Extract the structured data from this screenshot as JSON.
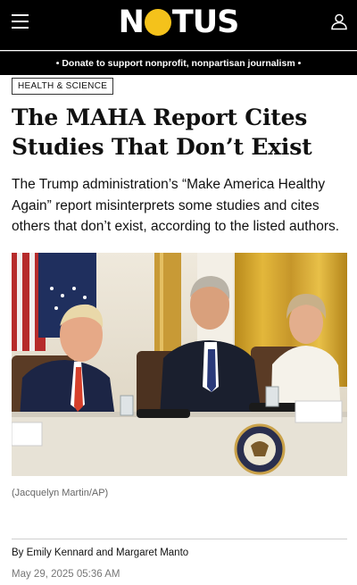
{
  "header": {
    "logo_text_left": "N",
    "logo_text_right": "TUS",
    "logo_accent_color": "#f4c21b",
    "menu_icon": "hamburger-menu-icon",
    "account_icon": "user-icon"
  },
  "donate_banner": {
    "text": "• Donate to support nonprofit, nonpartisan journalism •"
  },
  "article": {
    "section": "HEALTH & SCIENCE",
    "title": "The MAHA Report Cites Studies That Don’t Exist",
    "dek": "The Trump administration’s “Make America Healthy Again” report misinterprets some studies and cites others that don’t exist, according to the listed authors.",
    "photo_credit": "(Jacquelyn Martin/AP)",
    "byline_prefix": "By ",
    "author_1": "Emily Kennard",
    "byline_and": " and ",
    "author_2": "Margaret Manto",
    "date": "May 29, 2025 05:36 AM"
  },
  "colors": {
    "header_bg": "#000000",
    "accent_yellow": "#f4c21b"
  }
}
